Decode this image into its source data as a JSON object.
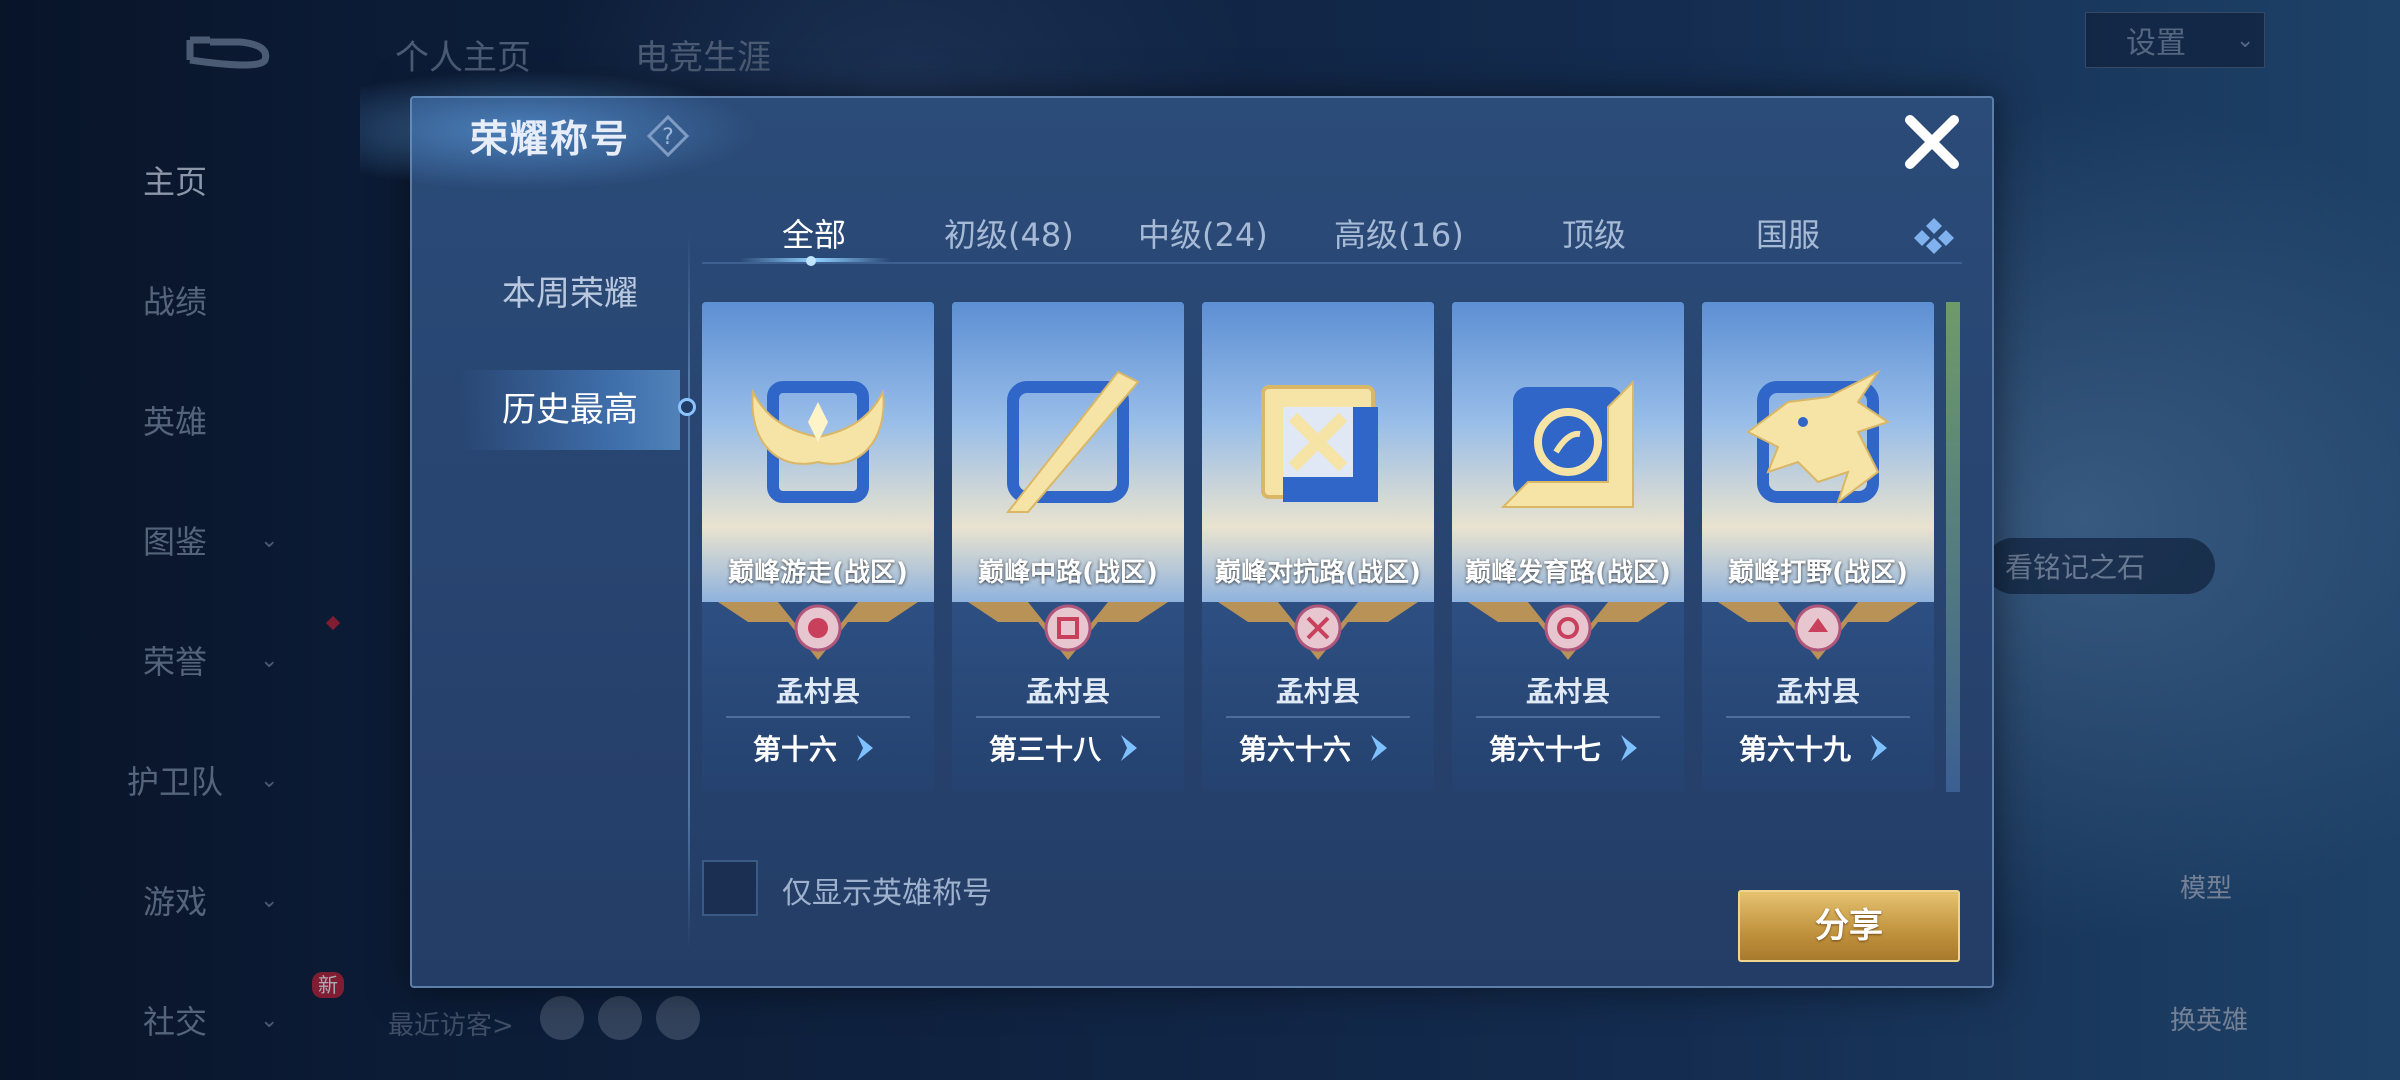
{
  "background": {
    "nav": [
      {
        "label": "主页",
        "chevron": false,
        "active": true
      },
      {
        "label": "战绩",
        "chevron": false
      },
      {
        "label": "英雄",
        "chevron": false
      },
      {
        "label": "图鉴",
        "chevron": true
      },
      {
        "label": "荣誉",
        "chevron": true
      },
      {
        "label": "护卫队",
        "chevron": true
      },
      {
        "label": "游戏",
        "chevron": true
      },
      {
        "label": "社交",
        "chevron": true
      }
    ],
    "new_badge": "新",
    "top_tabs": [
      "个人主页",
      "电竞生涯"
    ],
    "settings_label": "设置",
    "recent_visitors": "最近访客>",
    "inscription": "看铭记之石",
    "model_label": "模型",
    "change_hero_label": "换英雄"
  },
  "dialog": {
    "title": "荣耀称号",
    "side_tabs": [
      "本周荣耀",
      "历史最高"
    ],
    "active_side_tab": 1,
    "tabs": [
      "全部",
      "初级(48)",
      "中级(24)",
      "高级(16)",
      "顶级",
      "国服"
    ],
    "active_tab": 0,
    "cards": [
      {
        "title": "巅峰游走(战区)",
        "region": "孟村县",
        "rank": "第十六",
        "emblem": "wings-icon"
      },
      {
        "title": "巅峰中路(战区)",
        "region": "孟村县",
        "rank": "第三十八",
        "emblem": "slash-icon"
      },
      {
        "title": "巅峰对抗路(战区)",
        "region": "孟村县",
        "rank": "第六十六",
        "emblem": "crossed-swords-icon"
      },
      {
        "title": "巅峰发育路(战区)",
        "region": "孟村县",
        "rank": "第六十七",
        "emblem": "coin-icon"
      },
      {
        "title": "巅峰打野(战区)",
        "region": "孟村县",
        "rank": "第六十九",
        "emblem": "dragon-icon"
      }
    ],
    "checkbox_label": "仅显示英雄称号",
    "checkbox_checked": false,
    "share_label": "分享"
  },
  "colors": {
    "accent_gold": "#c0923d",
    "panel_blue": "#284470",
    "highlight_blue": "#8fd0ff"
  }
}
